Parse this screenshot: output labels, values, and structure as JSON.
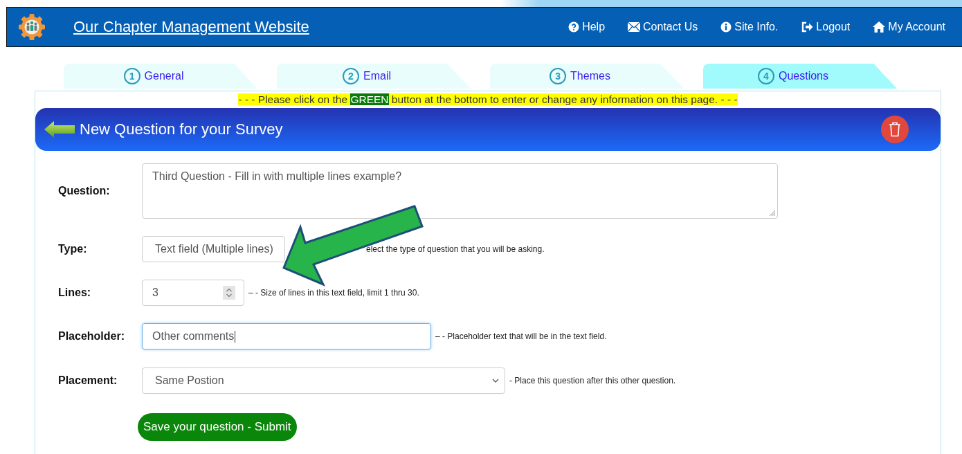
{
  "header": {
    "title": "Our Chapter Management Website",
    "nav": [
      {
        "kind": "help",
        "label": "Help"
      },
      {
        "kind": "mail",
        "label": "Contact Us"
      },
      {
        "kind": "info",
        "label": "Site Info."
      },
      {
        "kind": "logout",
        "label": "Logout"
      },
      {
        "kind": "home",
        "label": "My Account"
      }
    ]
  },
  "tabs": [
    {
      "number": "1",
      "label": "General",
      "selected": false
    },
    {
      "number": "2",
      "label": "Email",
      "selected": false
    },
    {
      "number": "3",
      "label": "Themes",
      "selected": false
    },
    {
      "number": "4",
      "label": "Questions",
      "selected": true
    }
  ],
  "notice": {
    "before": "- - - Please click on the ",
    "highlight": "GREEN",
    "after": " button at the bottom to enter or change any information on this page. - - -"
  },
  "panel_title": "New Question for your Survey",
  "form": [
    {
      "kind": "textarea",
      "label": "Question:",
      "value": "Third Question - Fill in with multiple lines example?"
    },
    {
      "kind": "select",
      "label": "Type:",
      "value": "Text field (Multiple lines)",
      "hint": "elect the type of question that you will be asking."
    },
    {
      "kind": "number",
      "label": "Lines:",
      "value": "3",
      "hint": "– - Size of lines in this text field, limit 1 thru 30."
    },
    {
      "kind": "text",
      "label": "Placeholder:",
      "value": "Other comments",
      "focused": true,
      "hint": "– - Placeholder text that will be in the text field."
    },
    {
      "kind": "dropdown",
      "label": "Placement:",
      "value": "Same Postion",
      "hint": "- Place this question after this other question."
    }
  ],
  "submit": "Save your question - Submit"
}
